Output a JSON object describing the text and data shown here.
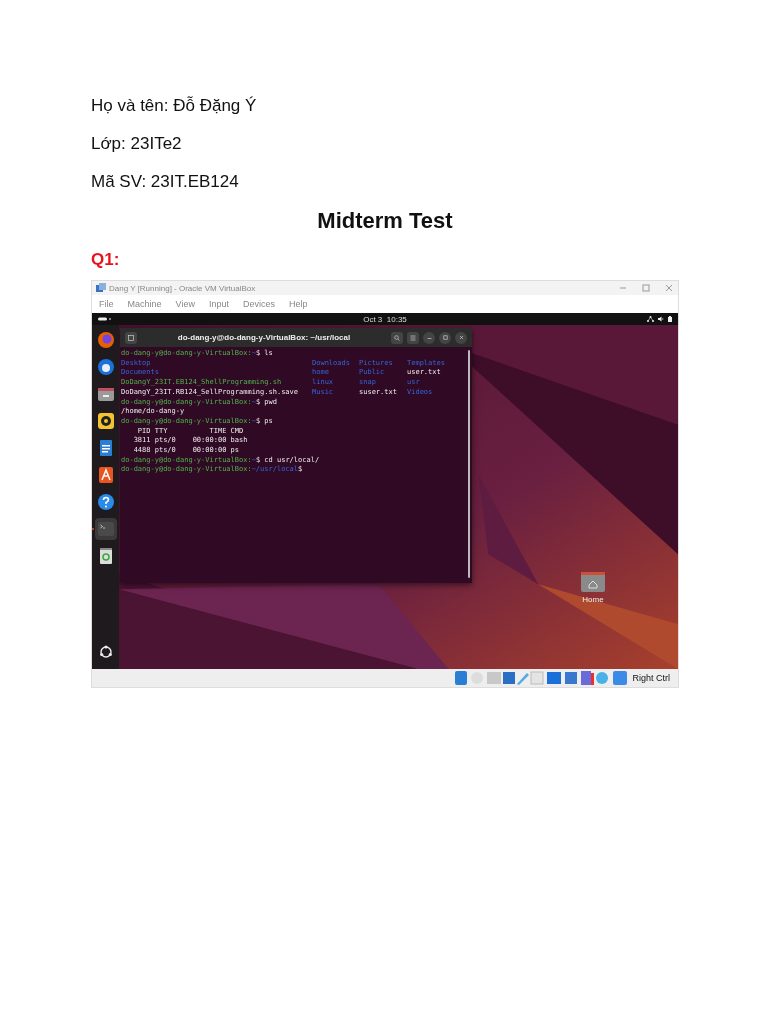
{
  "document": {
    "lines": [
      "Họ và tên: Đỗ Đặng Ý",
      "Lớp: 23ITe2",
      "Mã SV: 23IT.EB124"
    ],
    "title": "Midterm Test",
    "question": "Q1:"
  },
  "vbox": {
    "title": "Dang Y [Running] - Oracle VM VirtualBox",
    "menu": [
      "File",
      "Machine",
      "View",
      "Input",
      "Devices",
      "Help"
    ],
    "clock": "Oct 3  10:35",
    "dock": [
      {
        "kind": "firefox",
        "active": false
      },
      {
        "kind": "thunderbird",
        "active": false
      },
      {
        "kind": "files",
        "active": false
      },
      {
        "kind": "rhythmbox",
        "active": false
      },
      {
        "kind": "writer",
        "active": false
      },
      {
        "kind": "appcenter",
        "active": false
      },
      {
        "kind": "help",
        "active": false
      },
      {
        "kind": "terminal",
        "active": true
      },
      {
        "kind": "trash",
        "active": false
      }
    ],
    "terminal": {
      "title": "do-dang-y@do-dang-y-VirtualBox: ~/usr/local",
      "lines": [
        {
          "kind": "command",
          "user": "do-dang-y@do-dang-y-VirtualBox:",
          "path": "~",
          "command": "$ ls"
        },
        {
          "kind": "grid",
          "cells": [
            {
              "text": "Desktop",
              "kind": "dir"
            },
            {
              "text": "Downloads",
              "kind": "dir"
            },
            {
              "text": "Pictures",
              "kind": "dir"
            },
            {
              "text": "Templates",
              "kind": "dir"
            }
          ]
        },
        {
          "kind": "grid",
          "cells": [
            {
              "text": "Documents",
              "kind": "dir"
            },
            {
              "text": "home",
              "kind": "dir"
            },
            {
              "text": "Public",
              "kind": "dir"
            },
            {
              "text": "user.txt",
              "kind": "file"
            }
          ]
        },
        {
          "kind": "grid",
          "cells": [
            {
              "text": "DoDangY_23IT.EB124_ShellProgramming.sh",
              "kind": "exec"
            },
            {
              "text": "linux",
              "kind": "dir"
            },
            {
              "text": "snap",
              "kind": "dir"
            },
            {
              "text": "usr",
              "kind": "dir"
            }
          ]
        },
        {
          "kind": "grid",
          "cells": [
            {
              "text": "DoDangY_23IT.RB124_SellProgramming.sh.save",
              "kind": "file"
            },
            {
              "text": "Music",
              "kind": "dir"
            },
            {
              "text": "suser.txt",
              "kind": "file"
            },
            {
              "text": "Videos",
              "kind": "dir"
            }
          ]
        },
        {
          "kind": "command",
          "user": "do-dang-y@do-dang-y-VirtualBox:",
          "path": "~",
          "command": "$ pwd"
        },
        {
          "kind": "output",
          "text": "/home/do-dang-y"
        },
        {
          "kind": "command",
          "user": "do-dang-y@do-dang-y-VirtualBox:",
          "path": "~",
          "command": "$ ps"
        },
        {
          "kind": "output",
          "text": "    PID TTY          TIME CMD"
        },
        {
          "kind": "output",
          "text": "   3811 pts/0    00:00:00 bash"
        },
        {
          "kind": "output",
          "text": "   4488 pts/0    00:00:00 ps"
        },
        {
          "kind": "command",
          "user": "do-dang-y@do-dang-y-VirtualBox:",
          "path": "~",
          "command": "$ cd usr/local/"
        },
        {
          "kind": "command",
          "user": "do-dang-y@do-dang-y-VirtualBox:",
          "path": "~/usr/local",
          "command": "$"
        }
      ]
    },
    "desktop_icons": [
      {
        "label": "Home"
      }
    ],
    "status": {
      "host_key": "Right Ctrl"
    }
  }
}
